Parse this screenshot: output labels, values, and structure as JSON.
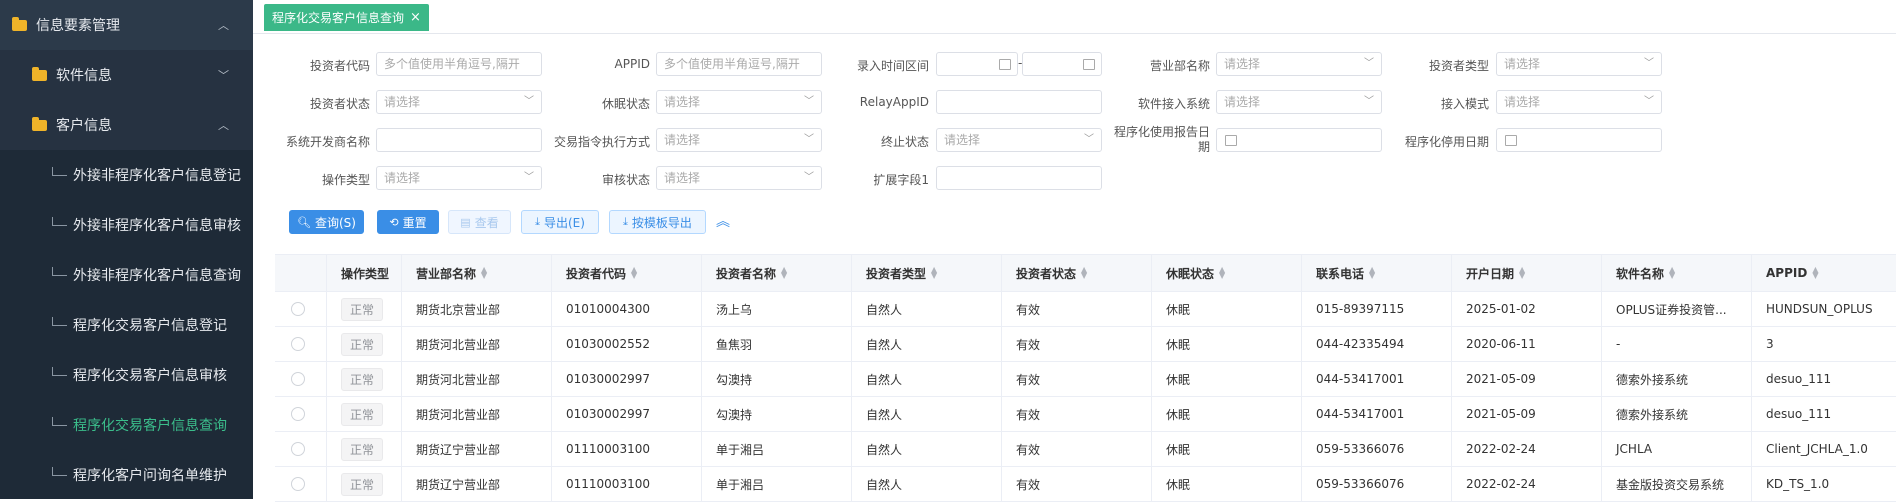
{
  "sidebar": {
    "top": "信息要素管理",
    "groups": [
      {
        "label": "软件信息"
      },
      {
        "label": "客户信息"
      }
    ],
    "items": [
      {
        "label": "外接非程序化客户信息登记"
      },
      {
        "label": "外接非程序化客户信息审核"
      },
      {
        "label": "外接非程序化客户信息查询"
      },
      {
        "label": "程序化交易客户信息登记"
      },
      {
        "label": "程序化交易客户信息审核"
      },
      {
        "label": "程序化交易客户信息查询"
      },
      {
        "label": "程序化客户问询名单维护"
      }
    ]
  },
  "tab": {
    "label": "程序化交易客户信息查询",
    "close": "×"
  },
  "form": {
    "investor_code": {
      "label": "投资者代码",
      "placeholder": "多个值使用半角逗号,隔开"
    },
    "appid": {
      "label": "APPID",
      "placeholder": "多个值使用半角逗号,隔开"
    },
    "entry_time": {
      "label": "录入时间区间",
      "sep": "-"
    },
    "branch": {
      "label": "营业部名称",
      "placeholder": "请选择"
    },
    "investor_type": {
      "label": "投资者类型",
      "placeholder": "请选择"
    },
    "investor_status": {
      "label": "投资者状态",
      "placeholder": "请选择"
    },
    "dormant_status": {
      "label": "休眠状态",
      "placeholder": "请选择"
    },
    "relay_appid": {
      "label": "RelayAppID",
      "placeholder": ""
    },
    "software_system": {
      "label": "软件接入系统",
      "placeholder": "请选择"
    },
    "access_mode": {
      "label": "接入模式",
      "placeholder": "请选择"
    },
    "developer": {
      "label": "系统开发商名称",
      "placeholder": ""
    },
    "exec_mode": {
      "label": "交易指令执行方式",
      "placeholder": "请选择"
    },
    "stop_status": {
      "label": "终止状态",
      "placeholder": "请选择"
    },
    "report_date_label1": "程序化使用报告日",
    "report_date_label2": "期",
    "stop_date": {
      "label": "程序化停用日期"
    },
    "op_type": {
      "label": "操作类型",
      "placeholder": "请选择"
    },
    "audit_status": {
      "label": "审核状态",
      "placeholder": "请选择"
    },
    "ext1": {
      "label": "扩展字段1",
      "placeholder": ""
    }
  },
  "buttons": {
    "query": "查询(S)",
    "reset": "重置",
    "view": "查看",
    "export": "导出(E)",
    "template_export": "按模板导出"
  },
  "table": {
    "headers": [
      "操作类型",
      "营业部名称",
      "投资者代码",
      "投资者名称",
      "投资者类型",
      "投资者状态",
      "休眠状态",
      "联系电话",
      "开户日期",
      "软件名称",
      "APPID"
    ],
    "rows": [
      [
        "正常",
        "期货北京营业部",
        "01010004300",
        "汤上乌",
        "自然人",
        "有效",
        "休眠",
        "015-89397115",
        "2025-01-02",
        "OPLUS证券投资管...",
        "HUNDSUN_OPLUS"
      ],
      [
        "正常",
        "期货河北营业部",
        "01030002552",
        "鱼焦羽",
        "自然人",
        "有效",
        "休眠",
        "044-42335494",
        "2020-06-11",
        "-",
        "3"
      ],
      [
        "正常",
        "期货河北营业部",
        "01030002997",
        "勾澳持",
        "自然人",
        "有效",
        "休眠",
        "044-53417001",
        "2021-05-09",
        "德索外接系统",
        "desuo_111"
      ],
      [
        "正常",
        "期货河北营业部",
        "01030002997",
        "勾澳持",
        "自然人",
        "有效",
        "休眠",
        "044-53417001",
        "2021-05-09",
        "德索外接系统",
        "desuo_111"
      ],
      [
        "正常",
        "期货辽宁营业部",
        "01110003100",
        "单于湘吕",
        "自然人",
        "有效",
        "休眠",
        "059-53366076",
        "2022-02-24",
        "JCHLA",
        "Client_JCHLA_1.0"
      ],
      [
        "正常",
        "期货辽宁营业部",
        "01110003100",
        "单于湘吕",
        "自然人",
        "有效",
        "休眠",
        "059-53366076",
        "2022-02-24",
        "基金版投资交易系统",
        "KD_TS_1.0"
      ]
    ]
  },
  "colors": {
    "accent": "#3bb888",
    "sidebar_bg": "#1e2a37",
    "primary": "#3a8ee6"
  }
}
